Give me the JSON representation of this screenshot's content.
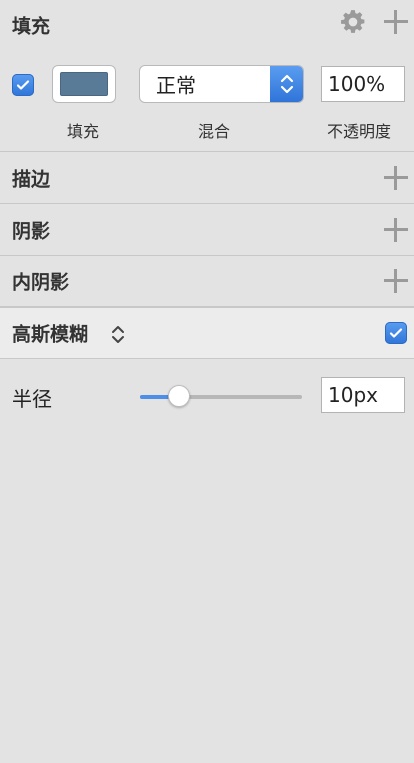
{
  "fill": {
    "title": "填充",
    "enabled": true,
    "color": "#5a7b98",
    "color_label": "填充",
    "blend_value": "正常",
    "blend_label": "混合",
    "opacity_value": "100%",
    "opacity_label": "不透明度"
  },
  "border": {
    "title": "描边"
  },
  "shadow": {
    "title": "阴影"
  },
  "inner_shadow": {
    "title": "内阴影"
  },
  "gaussian_blur": {
    "title": "高斯模糊",
    "enabled": true,
    "radius_label": "半径",
    "radius_value": "10px",
    "slider_fraction": 0.24
  },
  "colors": {
    "accent": "#3579dc",
    "panel_bg": "#e3e3e3",
    "icon_gray": "#9a9a9a"
  },
  "icons": [
    "gear-icon",
    "plus-icon",
    "checkmark-icon",
    "up-down-chevron-icon"
  ]
}
